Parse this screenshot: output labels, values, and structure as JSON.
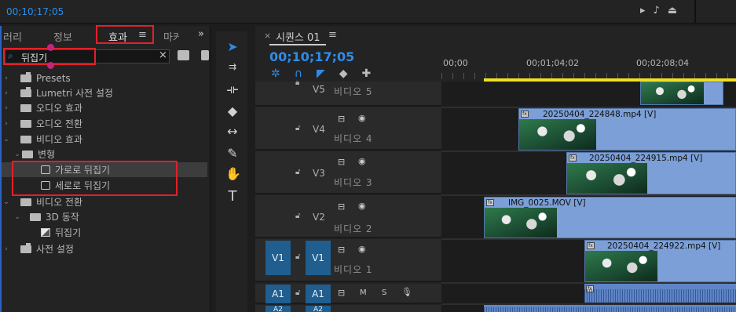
{
  "top": {
    "timecode": "00;10;17;05",
    "icons": [
      "insert-icon",
      "export-frame-icon"
    ]
  },
  "effects_panel": {
    "tabs": [
      "러리",
      "정보",
      "효과",
      "마커"
    ],
    "active_tab": "효과",
    "menu_glyph": "≡",
    "overflow_glyph": "»",
    "search": {
      "value": "뒤집기",
      "clear": "×"
    },
    "tree": [
      {
        "label": "Presets",
        "level": 0,
        "icon": "bin"
      },
      {
        "label": "Lumetri 사전 설정",
        "level": 0,
        "icon": "bin"
      },
      {
        "label": "오디오 효과",
        "level": 0,
        "icon": "folder"
      },
      {
        "label": "오디오 전환",
        "level": 0,
        "icon": "folder"
      },
      {
        "label": "비디오 효과",
        "level": 0,
        "icon": "folder"
      },
      {
        "label": "변형",
        "level": 1,
        "icon": "folder"
      },
      {
        "label": "가로로 뒤집기",
        "level": 2,
        "icon": "effect"
      },
      {
        "label": "세로로 뒤집기",
        "level": 2,
        "icon": "effect"
      },
      {
        "label": "비디오 전환",
        "level": 0,
        "icon": "folder"
      },
      {
        "label": "3D 동작",
        "level": 1,
        "icon": "folder"
      },
      {
        "label": "뒤집기",
        "level": 2,
        "icon": "transition"
      },
      {
        "label": "사전 설정",
        "level": 0,
        "icon": "bin"
      }
    ]
  },
  "tools": [
    "selection-icon",
    "track-select-icon",
    "ripple-edit-icon",
    "razor-icon",
    "slip-icon",
    "pen-icon",
    "hand-icon",
    "type-icon"
  ],
  "timeline": {
    "close": "×",
    "title": "시퀀스 01",
    "menu_glyph": "≡",
    "timecode": "00;10;17;05",
    "ruler": [
      "00;00",
      "00;01;04;02",
      "00;02;08;04"
    ],
    "tracks": [
      {
        "id": "V5",
        "name": "비디오 5"
      },
      {
        "id": "V4",
        "name": "비디오 4"
      },
      {
        "id": "V3",
        "name": "비디오 3"
      },
      {
        "id": "V2",
        "name": "비디오 2"
      },
      {
        "id": "V1",
        "name": "비디오 1",
        "source": "V1"
      }
    ],
    "audio": {
      "source": "A1",
      "id": "A1",
      "m": "M",
      "s": "S",
      "source2": "A2",
      "id2": "A2"
    },
    "clips": {
      "v4": "20250404_224848.mp4 [V]",
      "v3": "20250404_224915.mp4 [V]",
      "v2": "IMG_0025.MOV [V]",
      "v1": "20250404_224922.mp4 [V]"
    }
  }
}
